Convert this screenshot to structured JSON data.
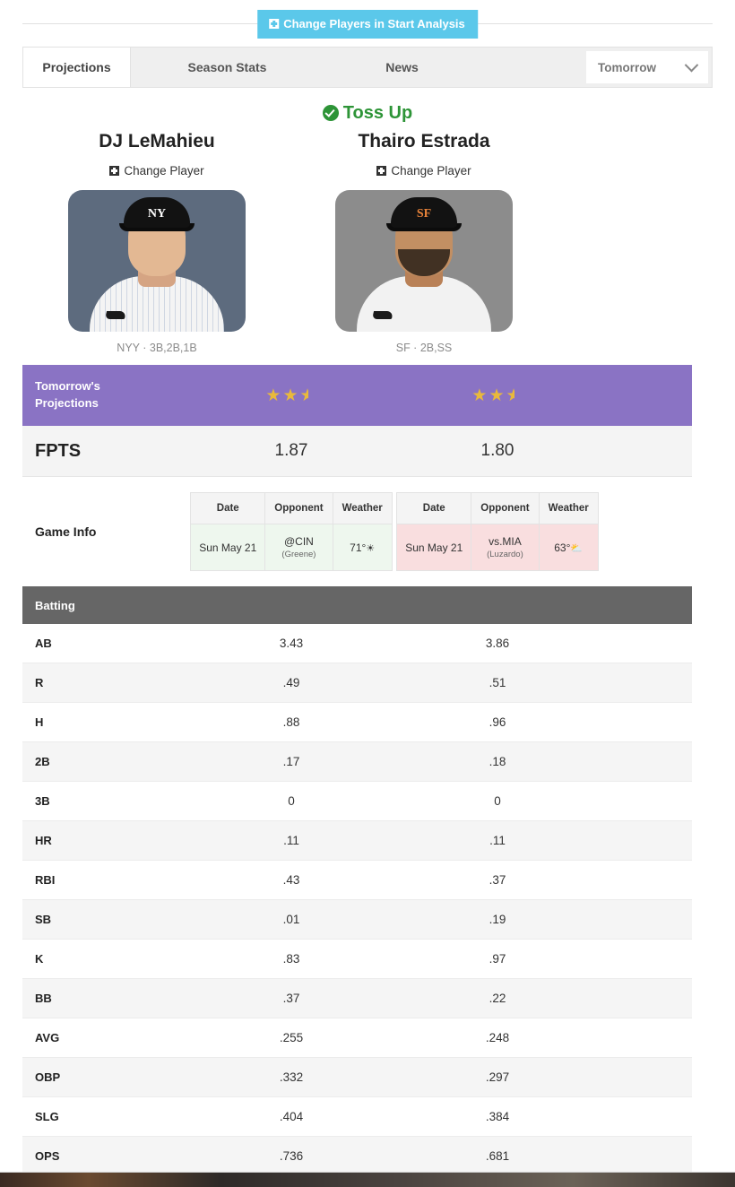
{
  "topbar": {
    "change_players_label": "Change Players in Start Analysis",
    "plus_icon": "plus-square-icon"
  },
  "tabs": {
    "items": [
      {
        "label": "Projections",
        "active": true
      },
      {
        "label": "Season Stats",
        "active": false
      },
      {
        "label": "News",
        "active": false
      }
    ],
    "date_select": {
      "value": "Tomorrow",
      "icon": "chevron-down-icon"
    }
  },
  "verdict": {
    "icon": "check-circle-icon",
    "label": "Toss Up",
    "color": "#2d9437"
  },
  "players": [
    {
      "name": "DJ LeMahieu",
      "change_player_label": "Change Player",
      "team": "NYY",
      "positions": "3B,2B,1B",
      "team_line": "NYY · 3B,2B,1B",
      "photo_bg": "#5d6b7e",
      "cap_logo": "NY",
      "stars": 2.5,
      "fpts": "1.87",
      "game": {
        "date": "Sun May 21",
        "opponent": "@CIN",
        "pitcher": "(Greene)",
        "weather_temp": "71°",
        "weather_icon": "sun-icon",
        "matchup_rating": "good"
      }
    },
    {
      "name": "Thairo Estrada",
      "change_player_label": "Change Player",
      "team": "SF",
      "positions": "2B,SS",
      "team_line": "SF · 2B,SS",
      "photo_bg": "#8c8c8c",
      "cap_logo": "SF",
      "stars": 2.5,
      "fpts": "1.80",
      "game": {
        "date": "Sun May 21",
        "opponent": "vs.MIA",
        "pitcher": "(Luzardo)",
        "weather_temp": "63°",
        "weather_icon": "cloud-sun-icon",
        "matchup_rating": "bad"
      }
    }
  ],
  "projections_band": {
    "label_line1": "Tomorrow's",
    "label_line2": "Projections",
    "bg_color": "#8a73c4",
    "star_color": "#e9b93c"
  },
  "fpts_row": {
    "label": "FPTS"
  },
  "game_info": {
    "label": "Game Info",
    "columns": [
      "Date",
      "Opponent",
      "Weather"
    ]
  },
  "batting": {
    "section_title": "Batting",
    "rows": [
      {
        "stat": "AB",
        "left": "3.43",
        "right": "3.86"
      },
      {
        "stat": "R",
        "left": ".49",
        "right": ".51"
      },
      {
        "stat": "H",
        "left": ".88",
        "right": ".96"
      },
      {
        "stat": "2B",
        "left": ".17",
        "right": ".18"
      },
      {
        "stat": "3B",
        "left": "0",
        "right": "0"
      },
      {
        "stat": "HR",
        "left": ".11",
        "right": ".11"
      },
      {
        "stat": "RBI",
        "left": ".43",
        "right": ".37"
      },
      {
        "stat": "SB",
        "left": ".01",
        "right": ".19"
      },
      {
        "stat": "K",
        "left": ".83",
        "right": ".97"
      },
      {
        "stat": "BB",
        "left": ".37",
        "right": ".22"
      },
      {
        "stat": "AVG",
        "left": ".255",
        "right": ".248"
      },
      {
        "stat": "OBP",
        "left": ".332",
        "right": ".297"
      },
      {
        "stat": "SLG",
        "left": ".404",
        "right": ".384"
      },
      {
        "stat": "OPS",
        "left": ".736",
        "right": ".681"
      }
    ]
  }
}
